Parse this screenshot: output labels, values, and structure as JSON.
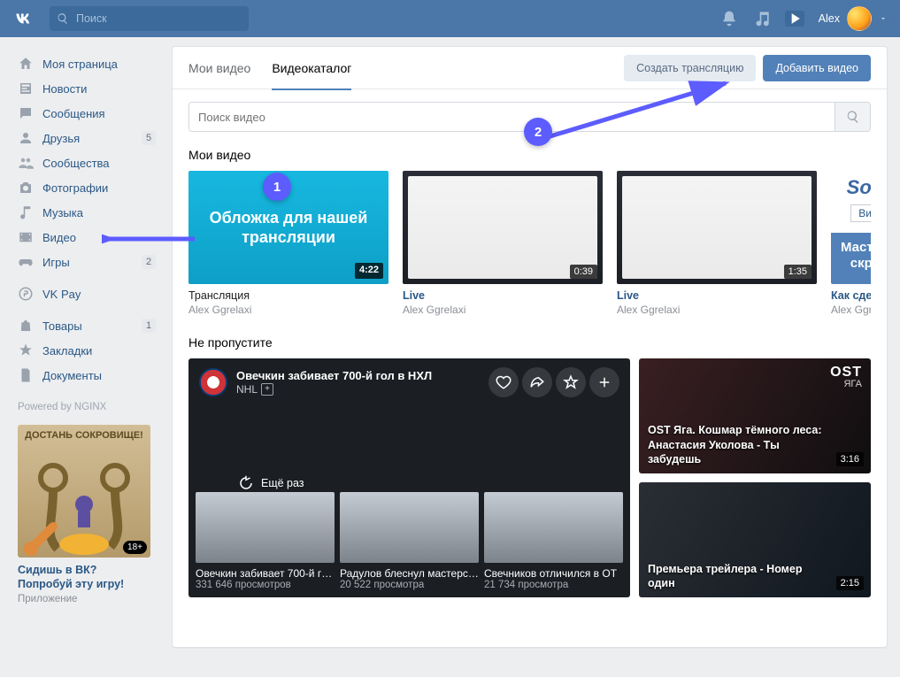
{
  "header": {
    "search_placeholder": "Поиск",
    "user_name": "Alex"
  },
  "sidebar": {
    "items": [
      {
        "icon": "home",
        "label": "Моя страница"
      },
      {
        "icon": "news",
        "label": "Новости"
      },
      {
        "icon": "msg",
        "label": "Сообщения"
      },
      {
        "icon": "friends",
        "label": "Друзья",
        "count": "5"
      },
      {
        "icon": "group",
        "label": "Сообщества"
      },
      {
        "icon": "photo",
        "label": "Фотографии"
      },
      {
        "icon": "music",
        "label": "Музыка"
      },
      {
        "icon": "video",
        "label": "Видео"
      },
      {
        "icon": "games",
        "label": "Игры",
        "count": "2"
      }
    ],
    "items2": [
      {
        "icon": "pay",
        "label": "VK Pay"
      }
    ],
    "items3": [
      {
        "icon": "bag",
        "label": "Товары",
        "count": "1"
      },
      {
        "icon": "star",
        "label": "Закладки"
      },
      {
        "icon": "doc",
        "label": "Документы"
      }
    ],
    "powered": "Powered by NGINX",
    "promo": {
      "banner": "ДОСТАНЬ СОКРОВИЩЕ!",
      "age": "18+",
      "caption": "Сидишь в ВК? Попробуй эту игру!",
      "sub": "Приложение"
    }
  },
  "tabs": {
    "my_videos": "Мои видео",
    "catalog": "Видеокаталог",
    "create_stream": "Создать трансляцию",
    "add_video": "Добавить видео"
  },
  "video_search_placeholder": "Поиск видео",
  "sections": {
    "my_videos_title": "Мои видео",
    "dont_miss_title": "Не пропустите"
  },
  "my_videos": [
    {
      "title": "Трансляция",
      "author": "Alex Ggrelaxi",
      "time": "4:22",
      "cover": "Обложка для нашей трансляции",
      "kind": "cyan"
    },
    {
      "title": "Live",
      "author": "Alex Ggrelaxi",
      "time": "0:39",
      "kind": "doc",
      "link": true
    },
    {
      "title": "Live",
      "author": "Alex Ggrelaxi",
      "time": "1:35",
      "kind": "doc",
      "link": true
    },
    {
      "title": "Как сдела",
      "author": "Alex Ggre",
      "time": "",
      "kind": "partial",
      "link": true,
      "corner_top": "Soc",
      "corner_btn": "Вид",
      "corner_line1": "Масте",
      "corner_line2": "скри"
    }
  ],
  "dont_miss": {
    "feature": {
      "title": "Овечкин забивает 700-й гол в НХЛ",
      "source": "NHL",
      "replay": "Ещё раз",
      "chips": [
        {
          "title": "Овечкин забивает 700-й г…",
          "views": "331 646 просмотров"
        },
        {
          "title": "Радулов блеснул мастерс…",
          "views": "20 522 просмотра"
        },
        {
          "title": "Свечников отличился в ОТ",
          "views": "21 734 просмотра"
        }
      ]
    },
    "side": [
      {
        "title": "OST Яга. Кошмар тёмного леса: Анастасия Уколова - Ты забудешь",
        "time": "3:16",
        "corner_t": "OST",
        "corner_b": "ЯГА"
      },
      {
        "title": "Премьера трейлера - Номер один",
        "time": "2:15"
      }
    ]
  },
  "callouts": {
    "one": "1",
    "two": "2"
  }
}
